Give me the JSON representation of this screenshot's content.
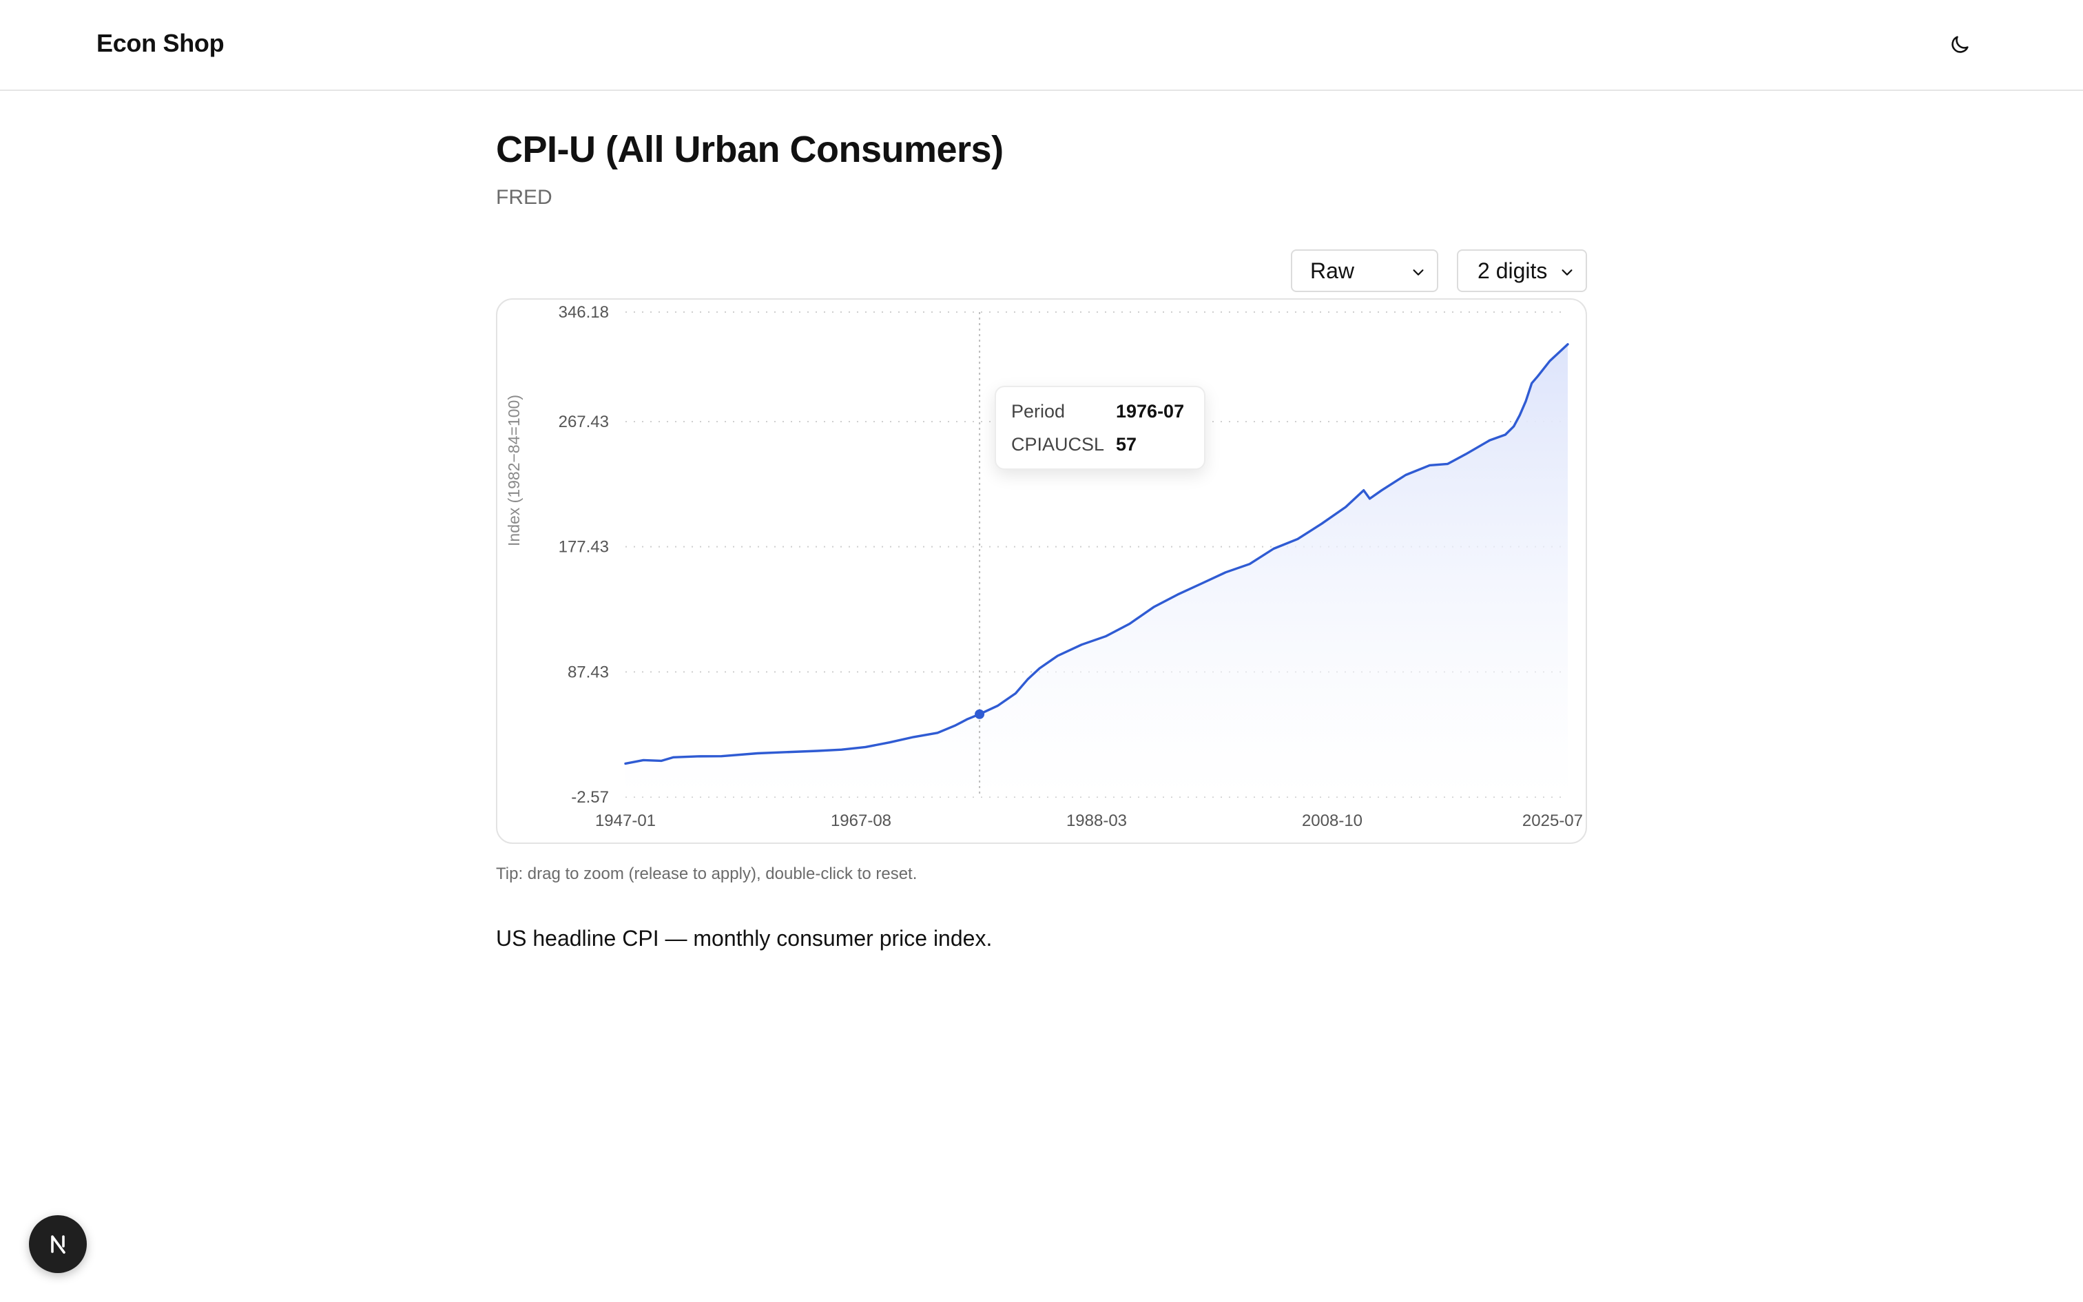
{
  "header": {
    "brand": "Econ Shop",
    "theme_toggle_icon": "moon-icon"
  },
  "page": {
    "title": "CPI-U (All Urban Consumers)",
    "source": "FRED",
    "tip": "Tip: drag to zoom (release to apply), double-click to reset.",
    "description": "US headline CPI — monthly consumer price index."
  },
  "controls": {
    "mode_selected": "Raw",
    "digits_selected": "2 digits"
  },
  "tooltip": {
    "period_label": "Period",
    "period_value": "1976-07",
    "series_label": "CPIAUCSL",
    "series_value": "57"
  },
  "colors": {
    "line": "#2f5bd3",
    "area_top": "#dde4fb",
    "grid": "#cfcfcf"
  },
  "dev_badge": {
    "label": "N",
    "icon": "nextjs-icon"
  },
  "chart_data": {
    "type": "area",
    "title": "",
    "xlabel": "",
    "ylabel": "Index (1982−84=100)",
    "x_tick_labels": [
      "1947-01",
      "1967-08",
      "1988-03",
      "2008-10",
      "2025-07"
    ],
    "y_tick_labels": [
      "346.18",
      "267.43",
      "177.43",
      "87.43",
      "-2.57"
    ],
    "ylim": [
      -2.57,
      346.18
    ],
    "xlim": [
      1947.0,
      2025.5
    ],
    "grid": true,
    "highlight": {
      "x": 1976.5,
      "y": 57
    },
    "series": [
      {
        "x": [
          1947.0,
          1948.5,
          1950.0,
          1951.0,
          1953.0,
          1955.0,
          1958.0,
          1960.0,
          1963.0,
          1965.0,
          1967.0,
          1969.0,
          1971.0,
          1973.0,
          1974.5,
          1975.5,
          1976.5,
          1978.0,
          1979.5,
          1980.5,
          1981.5,
          1983.0,
          1985.0,
          1987.0,
          1989.0,
          1991.0,
          1993.0,
          1995.0,
          1997.0,
          1999.0,
          2001.0,
          2003.0,
          2005.0,
          2007.0,
          2008.5,
          2009.0,
          2010.0,
          2012.0,
          2014.0,
          2015.5,
          2017.0,
          2019.0,
          2020.3,
          2021.0,
          2021.5,
          2022.0,
          2022.5,
          2023.0,
          2024.0,
          2025.5
        ],
        "y": [
          21.5,
          24.0,
          23.5,
          26.0,
          26.7,
          26.8,
          28.9,
          29.6,
          30.6,
          31.5,
          33.4,
          36.7,
          40.6,
          43.6,
          49.0,
          53.5,
          57.0,
          63.0,
          72.0,
          82.0,
          90.0,
          99.0,
          107.0,
          113.0,
          122.0,
          134.0,
          143.0,
          151.0,
          159.0,
          165.0,
          176.0,
          183.0,
          194.0,
          206.0,
          218.0,
          212.0,
          218.0,
          229.0,
          236.0,
          237.0,
          244.0,
          254.0,
          258.0,
          264.0,
          272.0,
          282.0,
          295.0,
          300.0,
          311.0,
          323.0
        ]
      }
    ]
  }
}
